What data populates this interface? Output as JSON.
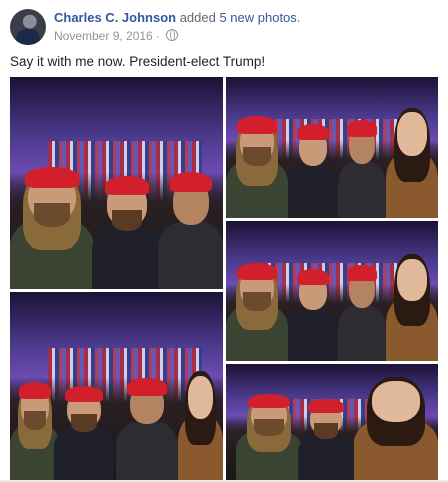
{
  "post": {
    "author": "Charles C. Johnson",
    "action": " added ",
    "photos_link": "5 new photos",
    "headline_end": ".",
    "date": "November 9, 2016 · ",
    "privacy_icon": "globe-icon",
    "text": "Say it with me now. President-elect Trump!"
  },
  "colors": {
    "link": "#365899",
    "text": "#1d2129",
    "meta": "#90949c",
    "hat": "#d21f2b"
  }
}
